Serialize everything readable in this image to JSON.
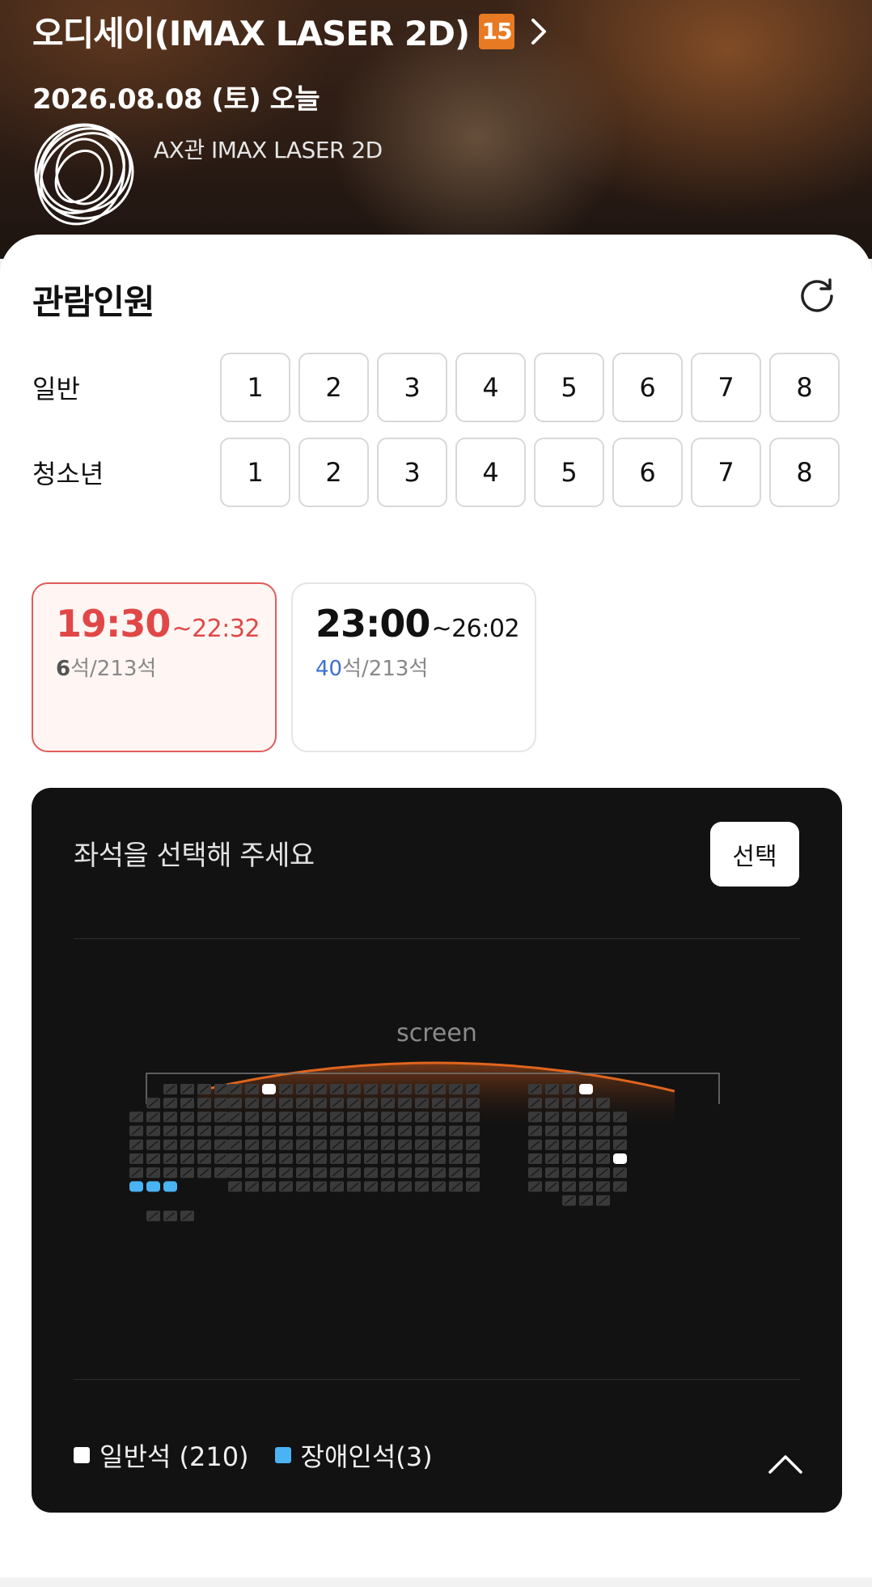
{
  "header": {
    "movie_title": "오디세이(IMAX LASER 2D)",
    "rating_badge": "15",
    "rating_color": "#e87a23",
    "date": "2026.08.08 (토) 오늘",
    "theater": "AX관 IMAX LASER 2D"
  },
  "audience": {
    "title": "관람인원",
    "rows": [
      {
        "label": "일반",
        "counts": [
          "1",
          "2",
          "3",
          "4",
          "5",
          "6",
          "7",
          "8"
        ]
      },
      {
        "label": "청소년",
        "counts": [
          "1",
          "2",
          "3",
          "4",
          "5",
          "6",
          "7",
          "8"
        ]
      }
    ]
  },
  "showtimes": [
    {
      "start": "19:30",
      "end": "~22:32",
      "available": "6",
      "total": "석/213석",
      "selected": true
    },
    {
      "start": "23:00",
      "end": "~26:02",
      "available": "40",
      "total": "석/213석",
      "selected": false
    }
  ],
  "seatmap": {
    "prompt": "좌석을 선택해 주세요",
    "select_button": "선택",
    "screen_label": "screen",
    "legend": [
      {
        "label": "일반석 (210)",
        "color": "#ffffff"
      },
      {
        "label": "장애인석(3)",
        "color": "#4ab3f4"
      }
    ],
    "colors": {
      "occupied": "#3a3a3a",
      "available": "#ffffff",
      "wheelchair": "#4ab3f4",
      "screen_glow": "#e0651e"
    }
  }
}
